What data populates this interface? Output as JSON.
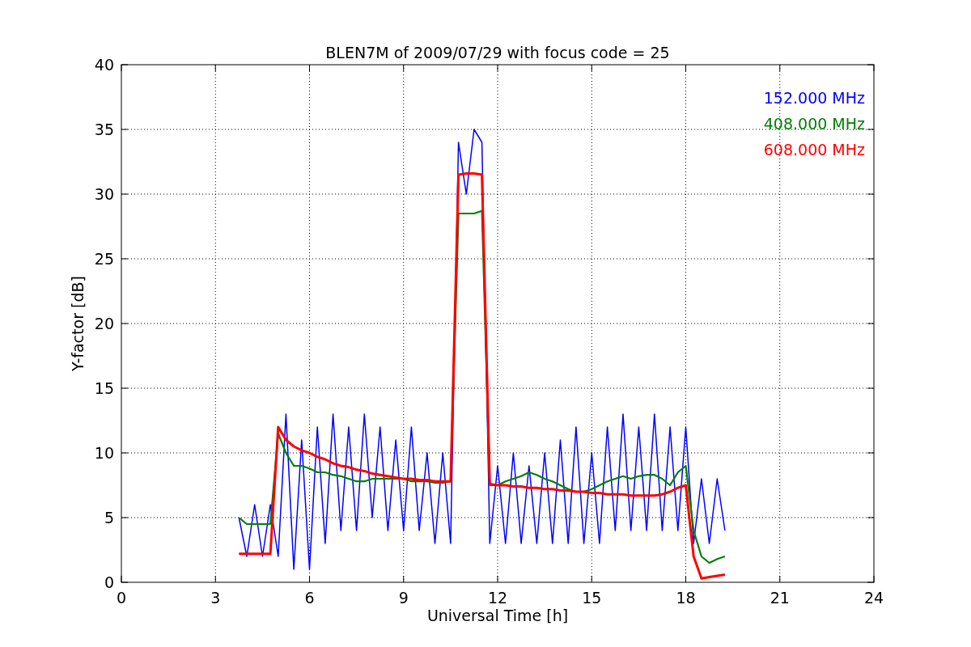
{
  "chart": {
    "chart_data": {
      "type": "line",
      "title": "BLEN7M of 2009/07/29 with focus code = 25",
      "xlabel": "Universal Time [h]",
      "ylabel": "Y-factor [dB]",
      "x": [
        3.75,
        4,
        4.25,
        4.5,
        4.75,
        5,
        5.25,
        5.5,
        5.75,
        6,
        6.25,
        6.5,
        6.75,
        7,
        7.25,
        7.5,
        7.75,
        8,
        8.25,
        8.5,
        8.75,
        9,
        9.25,
        9.5,
        9.75,
        10,
        10.25,
        10.5,
        10.75,
        11,
        11.25,
        11.5,
        11.75,
        12,
        12.25,
        12.5,
        12.75,
        13,
        13.25,
        13.5,
        13.75,
        14,
        14.25,
        14.5,
        14.75,
        15,
        15.25,
        15.5,
        15.75,
        16,
        16.25,
        16.5,
        16.75,
        17,
        17.25,
        17.5,
        17.75,
        18,
        18.25,
        18.5,
        18.75,
        19,
        19.25
      ],
      "series": [
        {
          "name": "152.000 MHz",
          "color": "#0000ff",
          "values": [
            5,
            2,
            6,
            2,
            6,
            2,
            13,
            1,
            11,
            1,
            12,
            3,
            13,
            4,
            12,
            4,
            13,
            5,
            12,
            4,
            11,
            4,
            12,
            4,
            10,
            3,
            10,
            3,
            34,
            30,
            35,
            34,
            3,
            9,
            3,
            10,
            3,
            9,
            3,
            10,
            3,
            11,
            3,
            12,
            3,
            10,
            3,
            12,
            4,
            13,
            4,
            12,
            4,
            13,
            4,
            12,
            4,
            12,
            3,
            8,
            3,
            8,
            4
          ]
        },
        {
          "name": "408.000 MHz",
          "color": "#008000",
          "values": [
            5,
            4.5,
            4.5,
            4.5,
            4.5,
            11.5,
            10,
            9,
            9,
            8.8,
            8.5,
            8.5,
            8.3,
            8.2,
            8,
            7.8,
            7.8,
            8,
            8,
            8,
            8,
            8,
            7.8,
            7.8,
            7.8,
            7.7,
            7.7,
            7.8,
            28.5,
            28.5,
            28.5,
            28.7,
            7.5,
            7.5,
            7.8,
            8,
            8.2,
            8.5,
            8.3,
            8,
            7.8,
            7.5,
            7.2,
            7,
            7,
            7.2,
            7.5,
            7.8,
            8,
            8.2,
            8,
            8.2,
            8.3,
            8.3,
            8,
            7.5,
            8.5,
            9,
            4,
            2,
            1.5,
            1.8,
            2
          ]
        },
        {
          "name": "608.000 MHz",
          "color": "#ff0000",
          "values": [
            2.2,
            2.2,
            2.2,
            2.2,
            2.2,
            12,
            11,
            10.5,
            10.2,
            10,
            9.7,
            9.5,
            9.2,
            9,
            8.9,
            8.7,
            8.6,
            8.4,
            8.3,
            8.2,
            8.1,
            8,
            8,
            7.9,
            7.9,
            7.8,
            7.8,
            7.8,
            31.5,
            31.6,
            31.6,
            31.5,
            7.6,
            7.5,
            7.5,
            7.4,
            7.4,
            7.3,
            7.3,
            7.2,
            7.2,
            7.1,
            7.1,
            7,
            7,
            6.9,
            6.9,
            6.8,
            6.8,
            6.8,
            6.7,
            6.7,
            6.7,
            6.7,
            6.8,
            7,
            7.3,
            7.5,
            2,
            0.3,
            0.4,
            0.5,
            0.6
          ]
        }
      ],
      "xlim": [
        0,
        24
      ],
      "ylim": [
        0,
        40
      ],
      "xticks": [
        0,
        3,
        6,
        9,
        12,
        15,
        18,
        21,
        24
      ],
      "yticks": [
        0,
        5,
        10,
        15,
        20,
        25,
        30,
        35,
        40
      ],
      "grid": true
    }
  }
}
